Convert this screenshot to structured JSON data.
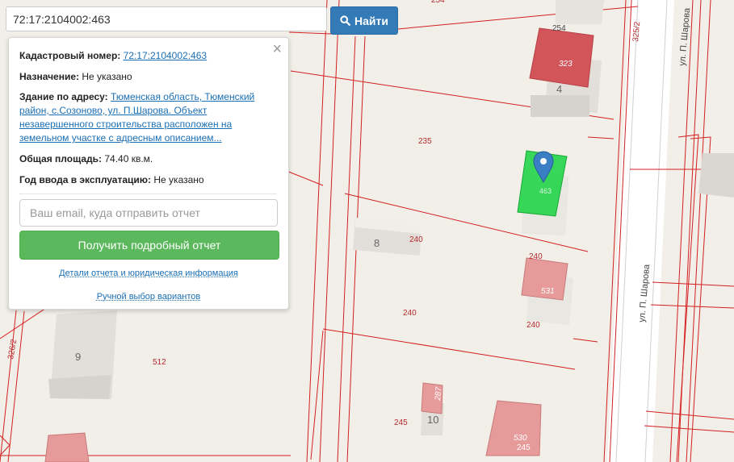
{
  "search": {
    "value": "72:17:2104002:463",
    "button_label": "Найти",
    "button_icon": "search-icon"
  },
  "info": {
    "cadastral_label": "Кадастровый номер:",
    "cadastral_value": "72:17:2104002:463",
    "purpose_label": "Назначение:",
    "purpose_value": "Не указано",
    "address_label": "Здание по адресу:",
    "address_line1": "Тюменская область, Тюменский",
    "address_line2": "район, с.Созоново, ул. П.Шарова. Объект",
    "address_line3": "незавершенного строительства расположен на",
    "address_line4": "земельном участке с адресным описанием...",
    "area_label": "Общая площадь:",
    "area_value": "74.40 кв.м.",
    "year_label": "Год ввода в эксплуатацию:",
    "year_value": "Не указано",
    "close_glyph": "×",
    "email_placeholder": "Ваш email, куда отправить отчет",
    "report_button": "Получить подробный отчет",
    "details_link": "Детали отчета и юридическая информация",
    "manual_link": "Ручной выбор вариантов"
  },
  "map": {
    "street_labels": [
      "ул. П. Шарова",
      "ул. П. Шарова"
    ],
    "parcel_labels": [
      "254",
      "254",
      "325/2",
      "323",
      "4",
      "235",
      "463",
      "8",
      "240",
      "240",
      "531",
      "240",
      "240",
      "326/2",
      "9",
      "512",
      "287",
      "10",
      "245",
      "530",
      "245"
    ],
    "colors": {
      "parcel_line": "#d42020",
      "building_red": "#d2555a",
      "building_pink": "#e79a9a",
      "selected": "#22d44a",
      "marker": "#3a7fc4"
    }
  }
}
